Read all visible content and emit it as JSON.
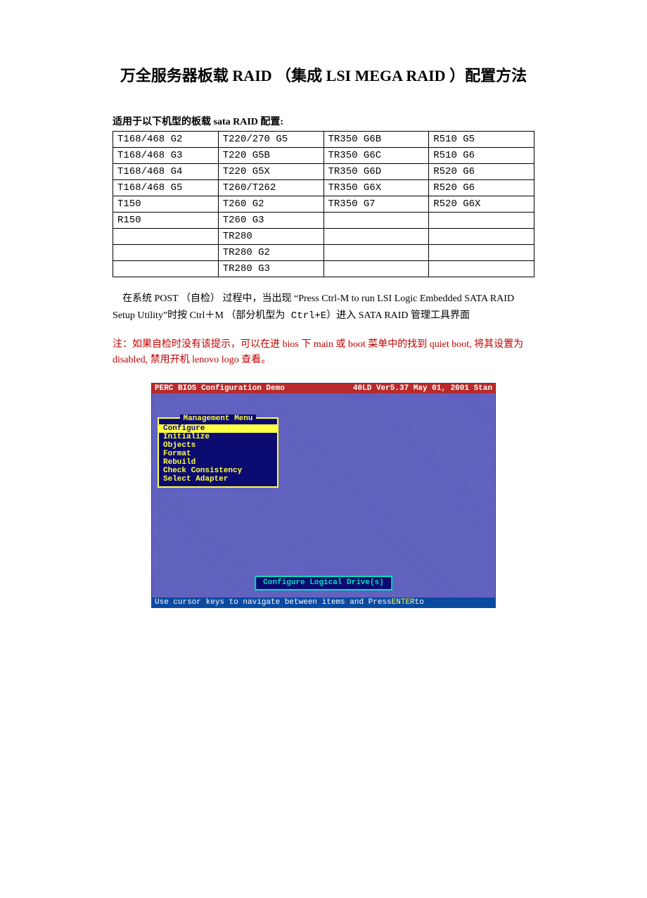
{
  "title": "万全服务器板载 RAID （集成 LSI MEGA RAID ）配置方法",
  "subtitle": "适用于以下机型的板载 sata RAID 配置:",
  "table": [
    [
      "T168/468 G2",
      "T220/270 G5",
      "TR350 G6B",
      "R510 G5"
    ],
    [
      "T168/468 G3",
      "T220 G5B",
      "TR350 G6C",
      "R510 G6"
    ],
    [
      "T168/468 G4",
      "T220 G5X",
      "TR350 G6D",
      "R520 G6"
    ],
    [
      "T168/468 G5",
      "T260/T262",
      "TR350 G6X",
      "R520 G6"
    ],
    [
      "T150",
      "T260 G2",
      "TR350 G7",
      "R520 G6X"
    ],
    [
      "R150",
      "T260 G3",
      "",
      ""
    ],
    [
      "",
      "TR280",
      "",
      ""
    ],
    [
      "",
      "TR280 G2",
      "",
      ""
    ],
    [
      "",
      "TR280 G3",
      "",
      ""
    ]
  ],
  "para1_a": "在系统 POST （自检） 过程中，当出现 “Press Ctrl-M to run LSI Logic Embedded SATA RAID",
  "para1_b": " Setup Utility”时按 Ctrl＋M ",
  "para1_c": "（部分机型为 Ctrl+E）",
  "para1_d": "进入 SATA RAID 管理工具界面",
  "note_a": "注：如果自检时没有该提示，可以在进 bios 下 main 或 boot 菜单中的找到 quiet boot, 将其设置为 disabled, 禁用开机 lenovo logo 查看。",
  "bios": {
    "top_left": "PERC BIOS Configuration Demo",
    "top_right": "40LD Ver5.37 May 01, 2001 Stan",
    "menu_title": "Management Menu",
    "items": [
      "Configure",
      "Initialize",
      "Objects",
      "Format",
      "Rebuild",
      "Check Consistency",
      "Select Adapter"
    ],
    "selected": 0,
    "tooltip": "Configure Logical Drive(s)",
    "bottom_a": "Use cursor keys to navigate between items and Press ",
    "bottom_b": "ENTER",
    "bottom_c": " to"
  }
}
